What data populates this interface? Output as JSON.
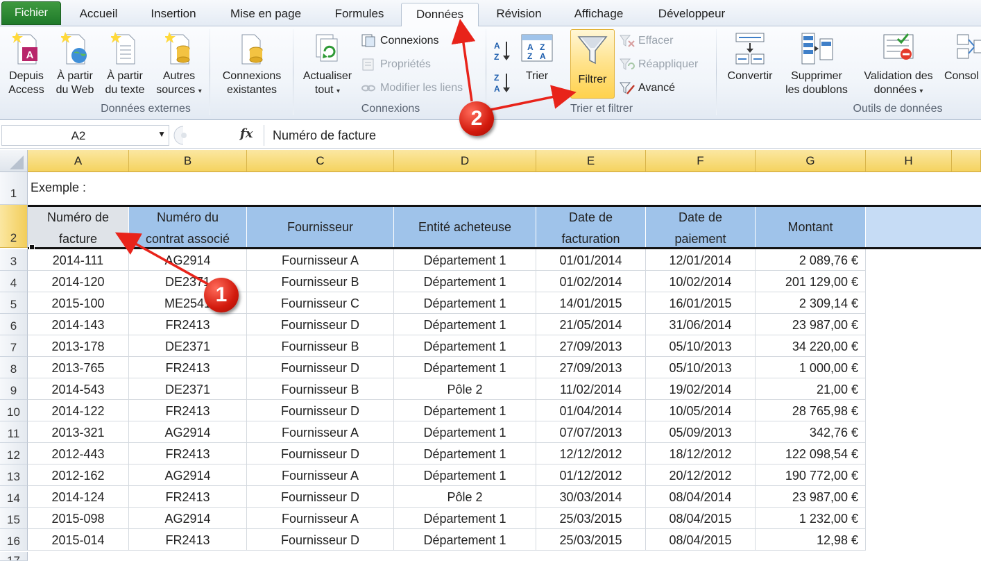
{
  "tabs": [
    {
      "label": "Fichier"
    },
    {
      "label": "Accueil"
    },
    {
      "label": "Insertion"
    },
    {
      "label": "Mise en page"
    },
    {
      "label": "Formules"
    },
    {
      "label": "Données"
    },
    {
      "label": "Révision"
    },
    {
      "label": "Affichage"
    },
    {
      "label": "Développeur"
    }
  ],
  "ribbon": {
    "donnees_externes": {
      "label": "Données externes",
      "access": [
        "Depuis",
        "Access"
      ],
      "web": [
        "À partir",
        "du Web"
      ],
      "texte": [
        "À partir",
        "du texte"
      ],
      "autres": [
        "Autres",
        "sources"
      ],
      "existantes": [
        "Connexions",
        "existantes"
      ]
    },
    "connexions": {
      "label": "Connexions",
      "actualiser": [
        "Actualiser",
        "tout"
      ],
      "connexions": "Connexions",
      "proprietes": "Propriétés",
      "modifier": "Modifier les liens"
    },
    "trier_filtrer": {
      "label": "Trier et filtrer",
      "trier": "Trier",
      "filtrer": "Filtrer",
      "effacer": "Effacer",
      "reappliquer": "Réappliquer",
      "avance": "Avancé"
    },
    "outils": {
      "label": "Outils de données",
      "convertir": "Convertir",
      "doublons": [
        "Supprimer",
        "les doublons"
      ],
      "validation": [
        "Validation des",
        "données"
      ],
      "consolider": "Consol"
    }
  },
  "formula_bar": {
    "name_box": "A2",
    "fx": "fx",
    "content": "Numéro de facture"
  },
  "columns": [
    "A",
    "B",
    "C",
    "D",
    "E",
    "F",
    "G",
    "H"
  ],
  "row1_text": "Exemple :",
  "header": {
    "a": [
      "Numéro de",
      "facture"
    ],
    "b": [
      "Numéro du",
      "contrat associé"
    ],
    "c": "Fournisseur",
    "d": "Entité acheteuse",
    "e": [
      "Date de",
      "facturation"
    ],
    "f": [
      "Date de",
      "paiement"
    ],
    "g": "Montant"
  },
  "rows": [
    {
      "n": "3",
      "a": "2014-111",
      "b": "AG2914",
      "c": "Fournisseur A",
      "d": "Département 1",
      "e": "01/01/2014",
      "f": "12/01/2014",
      "g": "2 089,76 €"
    },
    {
      "n": "4",
      "a": "2014-120",
      "b": "DE2371",
      "c": "Fournisseur B",
      "d": "Département 1",
      "e": "01/02/2014",
      "f": "10/02/2014",
      "g": "201 129,00 €"
    },
    {
      "n": "5",
      "a": "2015-100",
      "b": "ME2541",
      "c": "Fournisseur C",
      "d": "Département 1",
      "e": "14/01/2015",
      "f": "16/01/2015",
      "g": "2 309,14 €"
    },
    {
      "n": "6",
      "a": "2014-143",
      "b": "FR2413",
      "c": "Fournisseur D",
      "d": "Département 1",
      "e": "21/05/2014",
      "f": "31/06/2014",
      "g": "23 987,00 €"
    },
    {
      "n": "7",
      "a": "2013-178",
      "b": "DE2371",
      "c": "Fournisseur B",
      "d": "Département 1",
      "e": "27/09/2013",
      "f": "05/10/2013",
      "g": "34 220,00 €"
    },
    {
      "n": "8",
      "a": "2013-765",
      "b": "FR2413",
      "c": "Fournisseur D",
      "d": "Département 1",
      "e": "27/09/2013",
      "f": "05/10/2013",
      "g": "1 000,00 €"
    },
    {
      "n": "9",
      "a": "2014-543",
      "b": "DE2371",
      "c": "Fournisseur B",
      "d": "Pôle 2",
      "e": "11/02/2014",
      "f": "19/02/2014",
      "g": "21,00 €"
    },
    {
      "n": "10",
      "a": "2014-122",
      "b": "FR2413",
      "c": "Fournisseur D",
      "d": "Département 1",
      "e": "01/04/2014",
      "f": "10/05/2014",
      "g": "28 765,98 €"
    },
    {
      "n": "11",
      "a": "2013-321",
      "b": "AG2914",
      "c": "Fournisseur A",
      "d": "Département 1",
      "e": "07/07/2013",
      "f": "05/09/2013",
      "g": "342,76 €"
    },
    {
      "n": "12",
      "a": "2012-443",
      "b": "FR2413",
      "c": "Fournisseur D",
      "d": "Département 1",
      "e": "12/12/2012",
      "f": "18/12/2012",
      "g": "122 098,54 €"
    },
    {
      "n": "13",
      "a": "2012-162",
      "b": "AG2914",
      "c": "Fournisseur A",
      "d": "Département 1",
      "e": "01/12/2012",
      "f": "20/12/2012",
      "g": "190 772,00 €"
    },
    {
      "n": "14",
      "a": "2014-124",
      "b": "FR2413",
      "c": "Fournisseur D",
      "d": "Pôle 2",
      "e": "30/03/2014",
      "f": "08/04/2014",
      "g": "23 987,00 €"
    },
    {
      "n": "15",
      "a": "2015-098",
      "b": "AG2914",
      "c": "Fournisseur A",
      "d": "Département 1",
      "e": "25/03/2015",
      "f": "08/04/2015",
      "g": "1 232,00 €"
    },
    {
      "n": "16",
      "a": "2015-014",
      "b": "FR2413",
      "c": "Fournisseur D",
      "d": "Département 1",
      "e": "25/03/2015",
      "f": "08/04/2015",
      "g": "12,98 €"
    }
  ],
  "row_headers": [
    "1",
    "2",
    "17"
  ],
  "annotations": {
    "badge1": "1",
    "badge2": "2",
    "arrow_color": "#e8231a"
  },
  "colors": {
    "header_fill": "#9fc3ea",
    "selected_header": "#dfe3e8",
    "tab_highlight": "#f5d35f"
  }
}
